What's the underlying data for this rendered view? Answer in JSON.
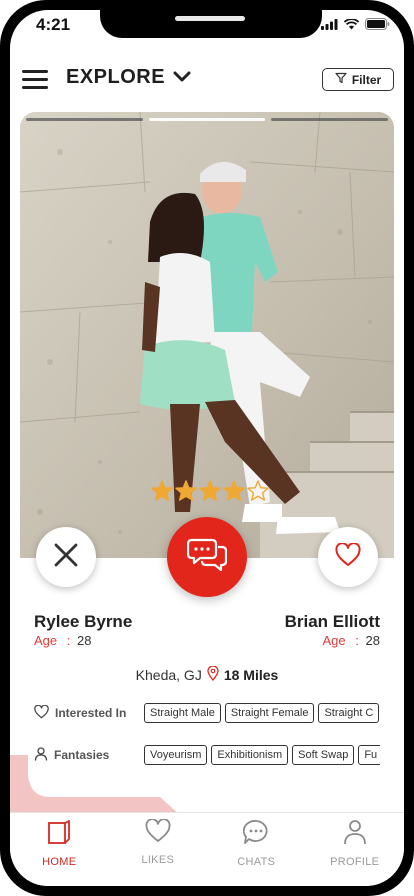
{
  "status_bar": {
    "time": "4:21"
  },
  "header": {
    "title": "EXPLORE",
    "filter_label": "Filter"
  },
  "card": {
    "photo_progress": {
      "total": 3,
      "active_index": 1
    },
    "rating": {
      "value": 4,
      "max": 5,
      "color": "#f0a832"
    },
    "person_left": {
      "name": "Rylee Byrne",
      "age_label": "Age",
      "age_sep": ":",
      "age": "28"
    },
    "person_right": {
      "name": "Brian Elliott",
      "age_label": "Age",
      "age_sep": ":",
      "age": "28"
    },
    "location": {
      "place": "Kheda, GJ",
      "distance": "18 Miles"
    },
    "interested_in": {
      "label": "Interested In",
      "chips": [
        "Straight Male",
        "Straight Female",
        "Straight C"
      ]
    },
    "fantasies": {
      "label": "Fantasies",
      "chips": [
        "Voyeurism",
        "Exhibitionism",
        "Soft Swap",
        "Fu"
      ]
    }
  },
  "tabs": [
    {
      "label": "HOME",
      "icon": "home-icon",
      "active": true
    },
    {
      "label": "LIKES",
      "icon": "heart-icon",
      "active": false
    },
    {
      "label": "CHATS",
      "icon": "chat-icon",
      "active": false
    },
    {
      "label": "PROFILE",
      "icon": "profile-icon",
      "active": false
    }
  ],
  "colors": {
    "accent": "#e2261c",
    "inactive": "#9a9a9a",
    "age_label": "#e23a3a"
  }
}
